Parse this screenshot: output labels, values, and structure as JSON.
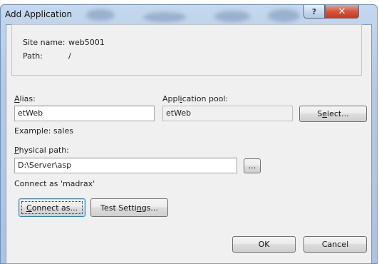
{
  "dialog": {
    "title": "Add Application",
    "help_glyph": "?",
    "close_glyph": "✕"
  },
  "info": {
    "site_name_label": "Site name:",
    "site_name_value": "web5001",
    "path_label": "Path:",
    "path_value": "/"
  },
  "alias": {
    "label_ul": "A",
    "label_rest": "lias:",
    "value": "etWeb",
    "example": "Example: sales"
  },
  "app_pool": {
    "label_pre": "Appl",
    "label_ul": "i",
    "label_rest": "cation pool:",
    "value": "etWeb",
    "select_pre": "S",
    "select_ul": "e",
    "select_rest": "lect..."
  },
  "physical_path": {
    "label_ul": "P",
    "label_rest": "hysical path:",
    "value": "D:\\Server\\asp",
    "browse_label": "...",
    "connect_status": "Connect as 'madrax'"
  },
  "buttons": {
    "connect_ul": "C",
    "connect_rest": "onnect as...",
    "test_pre": "Test Setti",
    "test_ul": "n",
    "test_rest": "gs...",
    "ok": "OK",
    "cancel": "Cancel"
  },
  "colors": {
    "title_gradient_top": "#c4d8ee",
    "close_button": "#c33a1f",
    "dialog_face": "#f0f0f0"
  }
}
